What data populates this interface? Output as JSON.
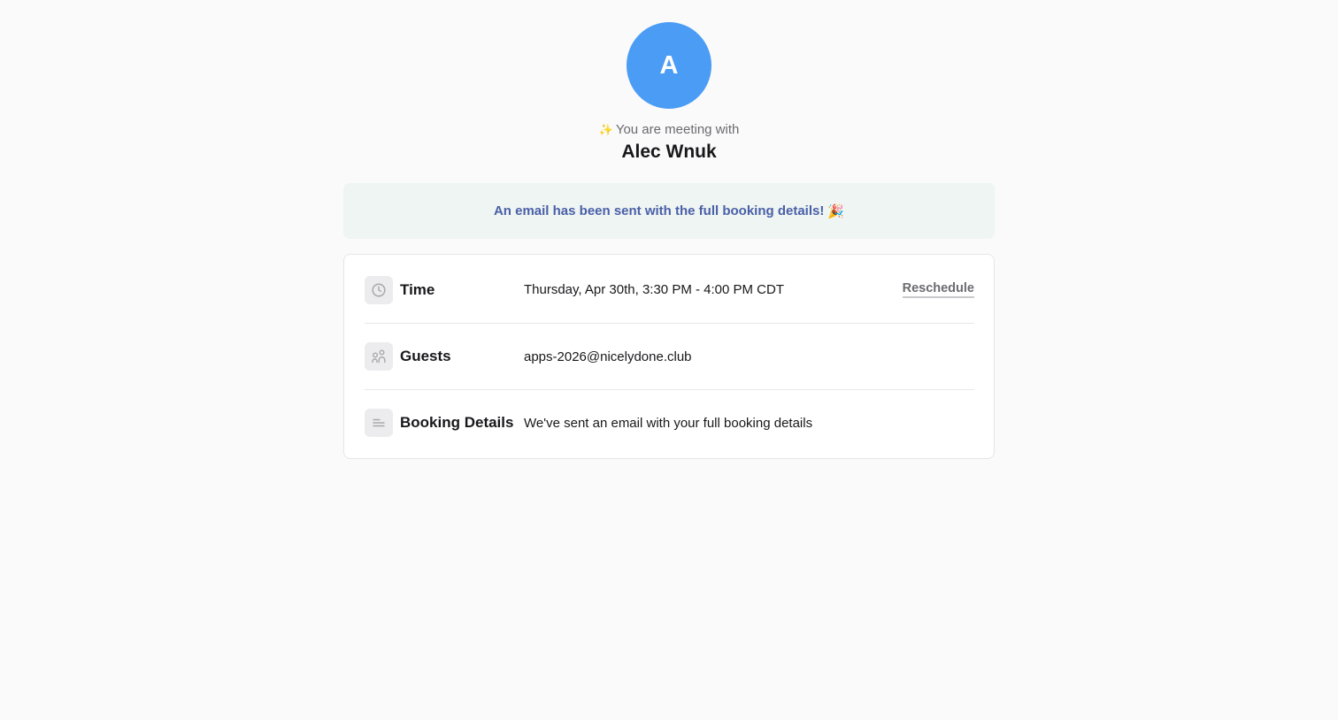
{
  "host": {
    "avatar_initial": "A",
    "meeting_prefix_icon": "sparkles-icon",
    "meeting_prefix_emoji": "✨",
    "meeting_prefix": "You are meeting with",
    "name": "Alec Wnuk",
    "avatar_color": "#4b9cf5"
  },
  "banner": {
    "message": "An email has been sent with the full booking details!",
    "emoji": "🎉"
  },
  "details": {
    "time": {
      "icon": "clock-icon",
      "label": "Time",
      "value": "Thursday, Apr 30th, 3:30 PM - 4:00 PM CDT",
      "action": "Reschedule"
    },
    "guests": {
      "icon": "people-icon",
      "label": "Guests",
      "value": "apps-2026@nicelydone.club"
    },
    "booking": {
      "icon": "text-lines-icon",
      "label": "Booking Details",
      "value": "We've sent an email with your full booking details"
    }
  }
}
